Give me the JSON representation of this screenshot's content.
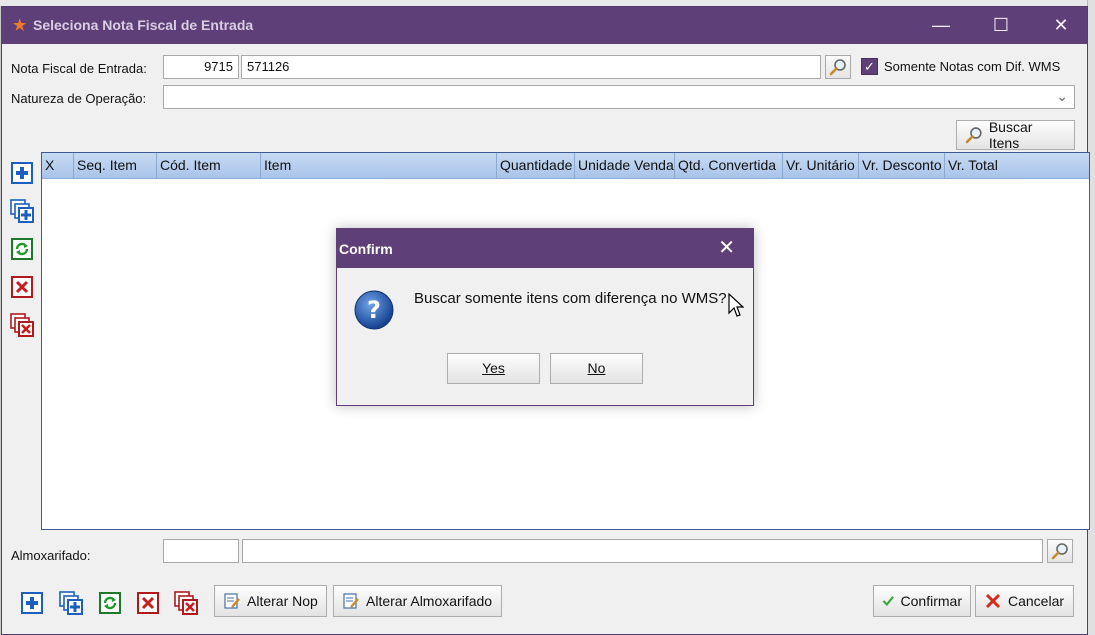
{
  "window": {
    "title": "Seleciona Nota Fiscal de Entrada",
    "minimize_glyph": "—",
    "maximize_glyph": "☐",
    "close_glyph": "✕"
  },
  "form": {
    "nota_fiscal_label": "Nota Fiscal de Entrada:",
    "nota_serie_value": "9715",
    "nota_numero_value": "571126",
    "somente_label": "Somente Notas com Dif. WMS",
    "somente_checked": true,
    "natureza_label": "Natureza de Operação:",
    "natureza_value": "",
    "buscar_itens_label": "Buscar Itens",
    "almoxarifado_label": "Almoxarifado:",
    "almoxarifado_code": "",
    "almoxarifado_name": ""
  },
  "grid": {
    "columns": [
      "X",
      "Seq. Item",
      "Cód. Item",
      "Item",
      "Quantidade",
      "Unidade Venda",
      "Qtd. Convertida",
      "Vr. Unitário",
      "Vr. Desconto",
      "Vr. Total"
    ],
    "rows": []
  },
  "side_toolbar": [
    "add-icon",
    "add-multiple-icon",
    "refresh-icon",
    "delete-icon",
    "delete-multiple-icon"
  ],
  "footer": {
    "alterar_nop_label": "Alterar Nop",
    "alterar_almoxarifado_label": "Alterar Almoxarifado",
    "confirmar_label": "Confirmar",
    "cancelar_label": "Cancelar"
  },
  "dialog": {
    "title": "Confirm",
    "message": "Buscar somente itens com diferença no WMS?",
    "yes_label": "Yes",
    "no_label": "No"
  },
  "colors": {
    "titlebar": "#5f3f78",
    "grid_header": "#b8cfee",
    "accent_blue": "#1d5fbf"
  }
}
